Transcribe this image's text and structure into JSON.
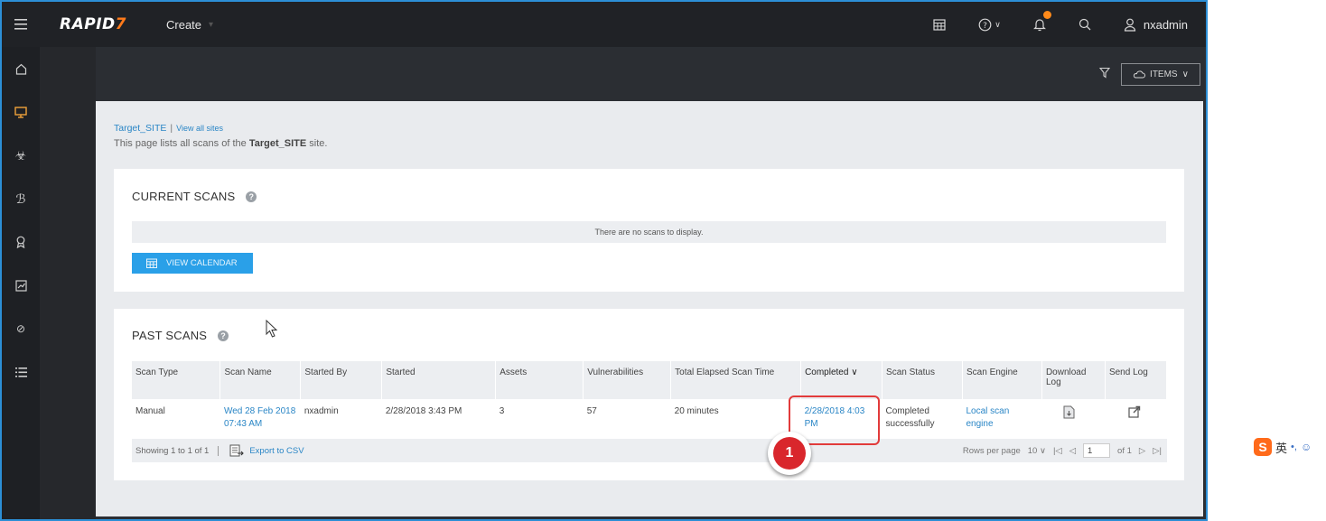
{
  "topbar": {
    "logo_main": "RAPID",
    "logo_accent": "7",
    "create_label": "Create",
    "username": "nxadmin"
  },
  "toolbar": {
    "items_label": "ITEMS"
  },
  "page": {
    "site_name": "Target_SITE",
    "separator": "|",
    "view_all_sites": "View all sites",
    "desc_prefix": "This page lists all scans of the",
    "desc_site": "Target_SITE",
    "desc_suffix": "site."
  },
  "current_scans": {
    "title": "CURRENT SCANS",
    "empty_message": "There are no scans to display.",
    "calendar_button": "VIEW CALENDAR"
  },
  "past_scans": {
    "title": "PAST SCANS",
    "columns": [
      "Scan Type",
      "Scan Name",
      "Started By",
      "Started",
      "Assets",
      "Vulnerabilities",
      "Total Elapsed Scan Time",
      "Completed",
      "Scan Status",
      "Scan Engine",
      "Download Log",
      "Send Log"
    ],
    "rows": [
      {
        "scan_type": "Manual",
        "scan_name": "Wed 28 Feb 2018 07:43 AM",
        "started_by": "nxadmin",
        "started": "2/28/2018 3:43 PM",
        "assets": "3",
        "vulnerabilities": "57",
        "elapsed": "20 minutes",
        "completed": "2/28/2018 4:03 PM",
        "status": "Completed successfully",
        "engine": "Local scan engine"
      }
    ],
    "showing": "Showing 1 to 1 of 1",
    "export_label": "Export to CSV",
    "rows_per_page_label": "Rows per page",
    "rows_per_page": "10",
    "page_number": "1",
    "page_of": "of 1"
  },
  "annotation": {
    "marker_number": "1"
  },
  "ime": {
    "lang_char": "英",
    "punct": "•,"
  },
  "colors": {
    "accent_blue": "#2aa0e8",
    "link_blue": "#2a86c6",
    "highlight_red": "#e23b3b",
    "brand_orange": "#ff7a1a"
  }
}
